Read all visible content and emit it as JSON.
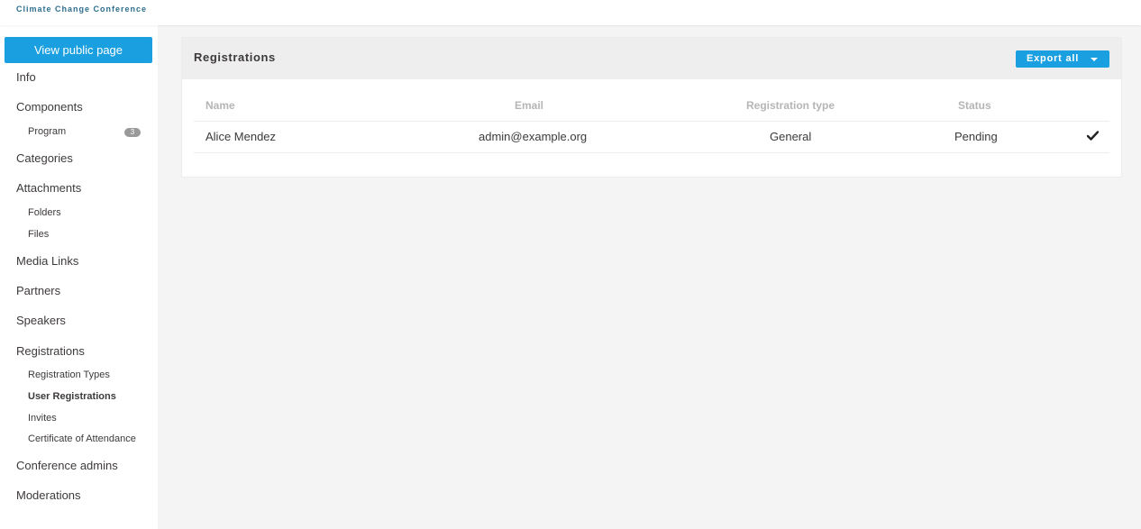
{
  "app": {
    "title": "Climate Change Conference"
  },
  "sidebar": {
    "public_button": "View public page",
    "items": {
      "info": "Info",
      "components": "Components",
      "program": "Program",
      "program_count": "3",
      "categories": "Categories",
      "attachments": "Attachments",
      "folders": "Folders",
      "files": "Files",
      "media_links": "Media Links",
      "partners": "Partners",
      "speakers": "Speakers",
      "registrations": "Registrations",
      "registration_types": "Registration Types",
      "user_registrations": "User Registrations",
      "invites": "Invites",
      "certificate": "Certificate of Attendance",
      "conference_admins": "Conference admins",
      "moderations": "Moderations"
    },
    "active_item": "User Registrations"
  },
  "main": {
    "title": "Registrations",
    "export_button": "Export all",
    "table": {
      "columns": [
        "Name",
        "Email",
        "Registration type",
        "Status"
      ],
      "rows": [
        {
          "name": "Alice Mendez",
          "email": "admin@example.org",
          "registration_type": "General",
          "status": "Pending",
          "action_icon": "check-icon"
        }
      ]
    }
  },
  "colors": {
    "accent": "#1a9fe0",
    "brand_text": "#2f6f8f",
    "badge": "#9a9a9a",
    "page_background": "#f4f4f4"
  }
}
